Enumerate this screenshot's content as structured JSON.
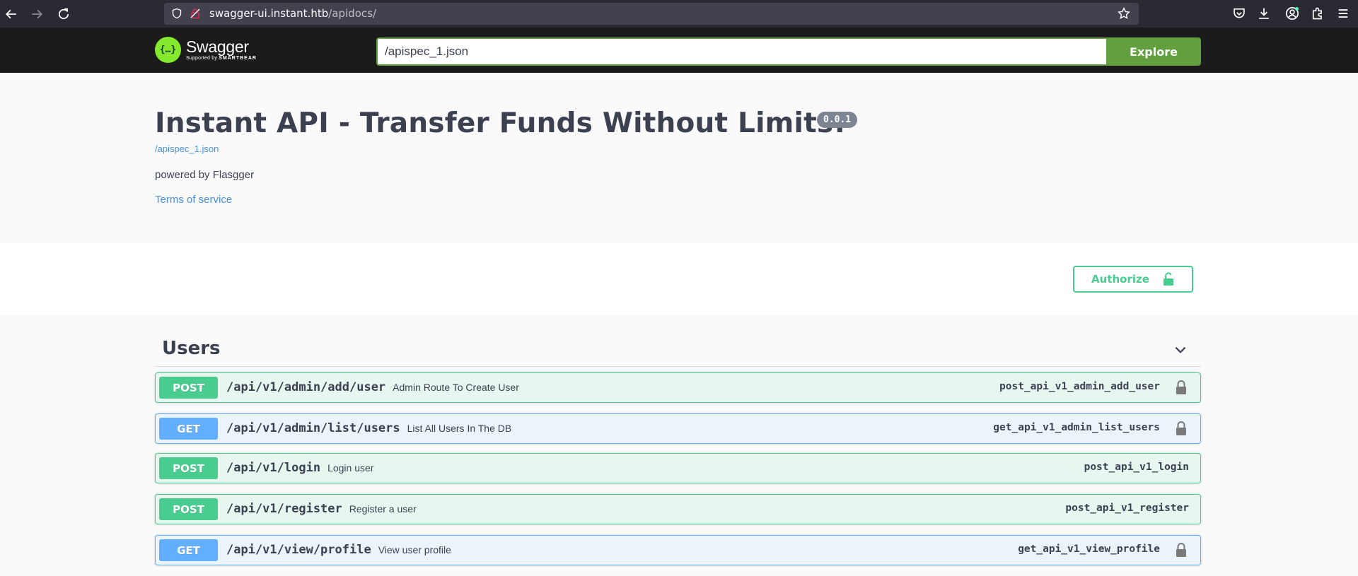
{
  "browser": {
    "url_host": "swagger-ui.instant.htb",
    "url_path": "/apidocs/",
    "icons": [
      "back-icon",
      "forward-icon",
      "reload-icon",
      "shield-icon",
      "lock-icon",
      "star-icon",
      "pocket-icon",
      "download-icon",
      "account-icon",
      "extensions-icon",
      "menu-icon"
    ]
  },
  "topbar": {
    "logo_name": "Swagger",
    "logo_sub_prefix": "Supported by",
    "logo_sub_brand": "SMARTBEAR",
    "spec_url": "/apispec_1.json",
    "explore_label": "Explore"
  },
  "info": {
    "title": "Instant API - Transfer Funds Without Limits!",
    "version": "0.0.1",
    "spec_link": "/apispec_1.json",
    "description": "powered by Flasgger",
    "terms_label": "Terms of service"
  },
  "auth": {
    "authorize_label": "Authorize"
  },
  "tag": {
    "name": "Users",
    "operations": [
      {
        "method": "POST",
        "path": "/api/v1/admin/add/user",
        "summary": "Admin Route To Create User",
        "operation_id": "post_api_v1_admin_add_user",
        "locked": true
      },
      {
        "method": "GET",
        "path": "/api/v1/admin/list/users",
        "summary": "List All Users In The DB",
        "operation_id": "get_api_v1_admin_list_users",
        "locked": true
      },
      {
        "method": "POST",
        "path": "/api/v1/login",
        "summary": "Login user",
        "operation_id": "post_api_v1_login",
        "locked": false
      },
      {
        "method": "POST",
        "path": "/api/v1/register",
        "summary": "Register a user",
        "operation_id": "post_api_v1_register",
        "locked": false
      },
      {
        "method": "GET",
        "path": "/api/v1/view/profile",
        "summary": "View user profile",
        "operation_id": "get_api_v1_view_profile",
        "locked": true
      }
    ]
  },
  "colors": {
    "post": "#49cc90",
    "get": "#61affe",
    "topbar_bg": "#1b1b1b",
    "explore_green": "#62a03f",
    "text": "#3b4151"
  }
}
